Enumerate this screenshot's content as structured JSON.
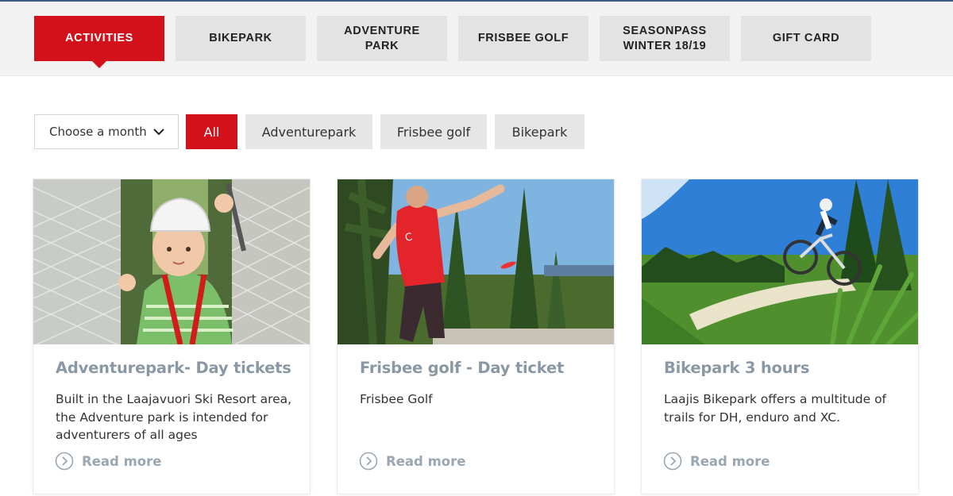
{
  "tabs": [
    {
      "label": "ACTIVITIES",
      "active": true
    },
    {
      "label": "BIKEPARK",
      "active": false
    },
    {
      "label": "ADVENTURE\nPARK",
      "active": false
    },
    {
      "label": "FRISBEE GOLF",
      "active": false
    },
    {
      "label": "SEASONPASS\nWINTER 18/19",
      "active": false
    },
    {
      "label": "GIFT CARD",
      "active": false
    }
  ],
  "filters": {
    "month_select": "Choose a month",
    "chips": [
      {
        "label": "All",
        "active": true
      },
      {
        "label": "Adventurepark",
        "active": false
      },
      {
        "label": "Frisbee golf",
        "active": false
      },
      {
        "label": "Bikepark",
        "active": false
      }
    ]
  },
  "cards": [
    {
      "title": "Adventurepark- Day tickets",
      "description": "Built in the Laajavuori Ski Resort area, the Adventure park is intended for adventurers of all ages",
      "read_more": "Read more",
      "image": "child-on-rope-net-photo"
    },
    {
      "title": "Frisbee golf - Day ticket",
      "description": "Frisbee Golf",
      "read_more": "Read more",
      "image": "disc-golf-player-photo"
    },
    {
      "title": "Bikepark 3 hours",
      "description": "Laajis Bikepark offers a multitude of trails for DH, enduro and XC.",
      "read_more": "Read more",
      "image": "mountain-biker-jump-photo"
    }
  ],
  "colors": {
    "accent": "#d2111b",
    "tab_bg": "#e3e3e3",
    "title_gray": "#8a98a6"
  }
}
